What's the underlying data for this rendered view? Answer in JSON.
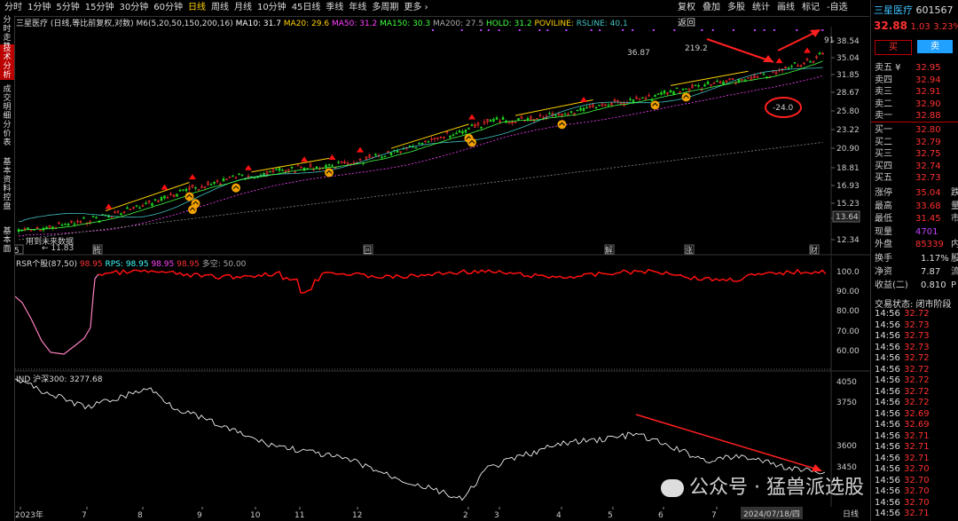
{
  "toolbar": {
    "tabs": [
      "分时",
      "1分钟",
      "5分钟",
      "15分钟",
      "30分钟",
      "60分钟",
      "日线",
      "周线",
      "月线",
      "10分钟",
      "45日线",
      "季线",
      "年线",
      "多周期",
      "更多 ›"
    ],
    "active_tab": "日线",
    "right_buttons": [
      "复权",
      "叠加",
      "多股",
      "统计",
      "画线",
      "标记",
      "-自选",
      "返回"
    ]
  },
  "left_tabs": [
    "分时走势",
    "技术分析",
    "成交明细",
    "分价表",
    "基本资料",
    "控盘",
    "基本面"
  ],
  "main_chart": {
    "legend_prefix": "三星医疗 (日线,等比前复权,对数) M6(5,20,50,150,200,16)",
    "legend_items": [
      {
        "text": "MA10: 31.7",
        "color": "#ffffff"
      },
      {
        "text": "MA20: 29.6",
        "color": "#ffd200"
      },
      {
        "text": "MA50: 31.2",
        "color": "#ff40ff"
      },
      {
        "text": "MA150: 30.3",
        "color": "#40ff40"
      },
      {
        "text": "MA200: 27.5",
        "color": "#aaaaaa"
      },
      {
        "text": "HOLD: 31.2",
        "color": "#40ff40"
      },
      {
        "text": "POVILINE:",
        "color": "#ffd200"
      },
      {
        "text": "RSLINE: 40.1",
        "color": "#40c0c0"
      }
    ],
    "y_ticks": [
      "38.54",
      "35.04",
      "31.85",
      "28.67",
      "25.80",
      "23.22",
      "20.90",
      "18.81",
      "16.93",
      "15.23",
      "13.64",
      "12.34"
    ],
    "current_price_label": "13.64",
    "annotations": {
      "high": "219.2",
      "mid": "36.87",
      "low": "11.83",
      "circle_value": "-24.0",
      "right_value": "91"
    },
    "marker_labels": [
      "5",
      "腾",
      "回",
      "解",
      "涨",
      "财"
    ],
    "bottom_note": "用到未来数据"
  },
  "rsr_chart": {
    "legend_title": "RSR个股(87,50)",
    "legend_items": [
      {
        "text": "98.95",
        "color": "#ff3030"
      },
      {
        "text": "RPS: 98.95",
        "color": "#40ffff"
      },
      {
        "text": "98.95",
        "color": "#ff40ff"
      },
      {
        "text": "98.95",
        "color": "#ff3030"
      },
      {
        "text": "多空: 50.00",
        "color": "#aaaaaa"
      }
    ],
    "y_ticks": [
      "100.0",
      "90.00",
      "80.00",
      "70.00",
      "60.00"
    ]
  },
  "ind_chart": {
    "legend": "IND 沪深300: 3277.68",
    "y_ticks": [
      "4050",
      "3750",
      "3600",
      "3450"
    ]
  },
  "x_axis": {
    "labels": [
      "2023年",
      "7",
      "8",
      "9",
      "10",
      "11",
      "12",
      "2",
      "3",
      "4",
      "5",
      "6",
      "7"
    ],
    "date_label": "2024/07/18/四",
    "period": "日线"
  },
  "watermark": "公众号 · 猛兽派选股",
  "quote": {
    "name": "三星医疗",
    "code": "601567",
    "price": "32.88",
    "change": "1.03",
    "change_pct": "3.23%",
    "buy_btn": "买",
    "sell_btn": "卖",
    "asks": [
      {
        "label": "卖五 ¥",
        "price": "32.95"
      },
      {
        "label": "卖四",
        "price": "32.94"
      },
      {
        "label": "卖三",
        "price": "32.91"
      },
      {
        "label": "卖二",
        "price": "32.90"
      },
      {
        "label": "卖一",
        "price": "32.88"
      }
    ],
    "bids": [
      {
        "label": "买一",
        "price": "32.80"
      },
      {
        "label": "买二",
        "price": "32.79"
      },
      {
        "label": "买三",
        "price": "32.75"
      },
      {
        "label": "买四",
        "price": "32.74"
      },
      {
        "label": "买五",
        "price": "32.73"
      }
    ],
    "stats": [
      {
        "label": "涨停",
        "value": "35.04",
        "color": "#ff3030",
        "extra": "跌"
      },
      {
        "label": "最高",
        "value": "33.68",
        "color": "#ff3030",
        "extra": "量"
      },
      {
        "label": "最低",
        "value": "31.45",
        "color": "#ff3030",
        "extra": "市"
      },
      {
        "label": "现量",
        "value": "4701",
        "color": "#c040ff",
        "extra": ""
      },
      {
        "label": "外盘",
        "value": "85339",
        "color": "#ff3030",
        "extra": "内"
      }
    ],
    "stats2": [
      {
        "label": "换手",
        "value": "1.17%",
        "extra": "股"
      },
      {
        "label": "净资",
        "value": "7.87",
        "extra": "流"
      },
      {
        "label": "收益(二)",
        "value": "0.810",
        "extra": "P"
      }
    ],
    "status": "交易状态: 闭市阶段",
    "ticks": [
      {
        "time": "14:56",
        "price": "32.72"
      },
      {
        "time": "14:56",
        "price": "32.73"
      },
      {
        "time": "14:56",
        "price": "32.73"
      },
      {
        "time": "14:56",
        "price": "32.73"
      },
      {
        "time": "14:56",
        "price": "32.72"
      },
      {
        "time": "14:56",
        "price": "32.72"
      },
      {
        "time": "14:56",
        "price": "32.72"
      },
      {
        "time": "14:56",
        "price": "32.72"
      },
      {
        "time": "14:56",
        "price": "32.72"
      },
      {
        "time": "14:56",
        "price": "32.69"
      },
      {
        "time": "14:56",
        "price": "32.69"
      },
      {
        "time": "14:56",
        "price": "32.71"
      },
      {
        "time": "14:56",
        "price": "32.71"
      },
      {
        "time": "14:56",
        "price": "32.71"
      },
      {
        "time": "14:56",
        "price": "32.70"
      },
      {
        "time": "14:56",
        "price": "32.70"
      },
      {
        "time": "14:56",
        "price": "32.70"
      },
      {
        "time": "14:56",
        "price": "32.70"
      },
      {
        "time": "14:56",
        "price": "32.71"
      }
    ]
  },
  "colors": {
    "up": "#ff3030",
    "down": "#20d020",
    "bg": "#000000",
    "accent": "#ffd200"
  }
}
